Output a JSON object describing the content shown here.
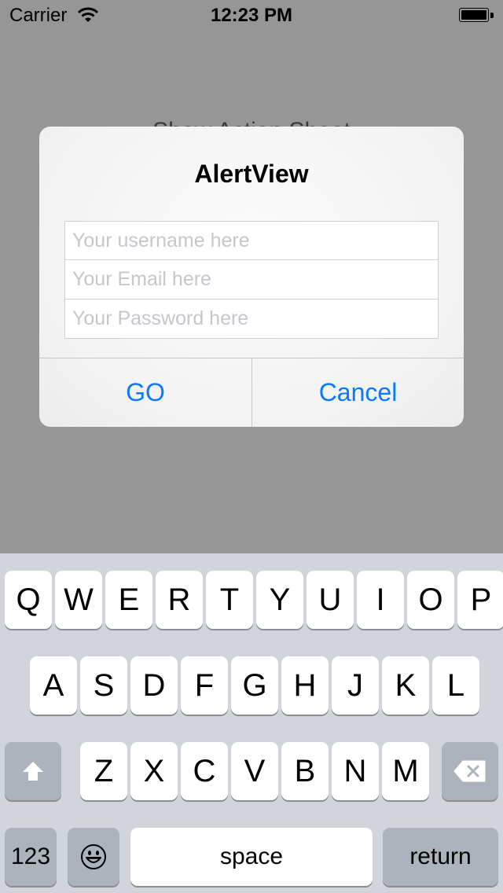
{
  "status_bar": {
    "carrier": "Carrier",
    "time": "12:23 PM"
  },
  "background": {
    "button_label": "Show Action Sheet"
  },
  "alert": {
    "title": "AlertView",
    "fields": [
      {
        "placeholder": "Your username here",
        "value": ""
      },
      {
        "placeholder": "Your Email here",
        "value": ""
      },
      {
        "placeholder": "Your Password here",
        "value": ""
      }
    ],
    "buttons": {
      "go": "GO",
      "cancel": "Cancel"
    },
    "accent_color": "#0a7aff"
  },
  "keyboard": {
    "row1": [
      "Q",
      "W",
      "E",
      "R",
      "T",
      "Y",
      "U",
      "I",
      "O",
      "P"
    ],
    "row2": [
      "A",
      "S",
      "D",
      "F",
      "G",
      "H",
      "J",
      "K",
      "L"
    ],
    "row3": [
      "Z",
      "X",
      "C",
      "V",
      "B",
      "N",
      "M"
    ],
    "shift_icon": "shift-arrow-icon",
    "delete_icon": "backspace-icon",
    "numbers_label": "123",
    "emoji_icon": "emoji-face-icon",
    "space_label": "space",
    "return_label": "return"
  }
}
